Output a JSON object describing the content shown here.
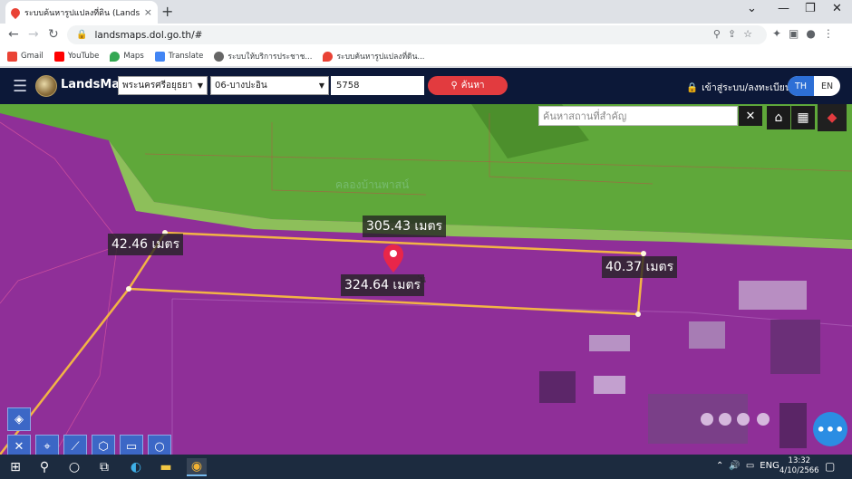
{
  "browser": {
    "tab_title": "ระบบค้นหารูปแปลงที่ดิน (LandsMaps) ...",
    "tab_close": "×",
    "new_tab": "+",
    "url": "landsmaps.dol.go.th/#",
    "window_controls": [
      "⌄",
      "—",
      "❐",
      "✕"
    ],
    "bookmarks": [
      {
        "label": "Gmail",
        "icon": "gmail-icon",
        "color": "#ea4335"
      },
      {
        "label": "YouTube",
        "icon": "youtube-icon",
        "color": "#ff0000"
      },
      {
        "label": "Maps",
        "icon": "maps-icon",
        "color": "#34a853"
      },
      {
        "label": "Translate",
        "icon": "translate-icon",
        "color": "#4285f4"
      },
      {
        "label": "ระบบให้บริการประชาช...",
        "icon": "gov-service-icon",
        "color": "#666666"
      },
      {
        "label": "ระบบค้นหารูปแปลงที่ดิน...",
        "icon": "map-pin-icon",
        "color": "#e94235"
      }
    ]
  },
  "app": {
    "brand": "LandsMaps",
    "province": "พระนครศรีอยุธยา",
    "district": "06-บางปะอิน",
    "parcel_number": "5758",
    "search_label": "ค้นหา",
    "login_label": "เข้าสู่ระบบ/ลงทะเบียน",
    "lang_th": "TH",
    "lang_en": "EN"
  },
  "map": {
    "place_search_placeholder": "ค้นหาสถานที่สำคัญ",
    "clear_label": "✕",
    "canal_label": "คลองบ้านพาสน์",
    "parcel_label_fragment": "ุ่น",
    "measurements": {
      "top": "305.43 เมตร",
      "left": "42.46 เมตร",
      "right": "40.37 เมตร",
      "bottom": "324.64 เมตร"
    },
    "colors": {
      "parcel_outline": "#f2b445",
      "marker": "#e8264a",
      "land_overlay": "#8f2f98",
      "field_green": "#5fa83a"
    }
  },
  "taskbar": {
    "tray_lang": "ENG",
    "time": "13:32",
    "date": "4/10/2566"
  }
}
